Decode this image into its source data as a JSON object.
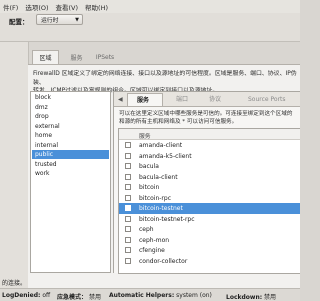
{
  "menubar": {
    "items": [
      "件(F)",
      "选项(O)",
      "查看(V)",
      "帮助(H)"
    ]
  },
  "config": {
    "label": "配置：",
    "value": "运行时"
  },
  "top_tabs": [
    "区域",
    "服务",
    "IPSets"
  ],
  "description": [
    "FirewallD 区域定义了绑定的网络连接、接口以及源地址的可信程度。区域是服务、端口、协议、IP伪装、",
    "转发、ICMP过滤以及富规则的组合。区域可以绑定到接口以及源地址。"
  ],
  "zones": [
    "block",
    "dmz",
    "drop",
    "external",
    "home",
    "internal",
    "public",
    "trusted",
    "work"
  ],
  "selected_zone": "public",
  "sub_tabs": [
    "服务",
    "端口",
    "协议",
    "Source Ports"
  ],
  "service_desc": [
    "可以在这里定义区域中哪些服务是可信的。可连接至绑定到这个区域的",
    "和源的所有主机和网络及 * 可以访问可信服务。"
  ],
  "service_column": "服务",
  "services": [
    {
      "name": "amanda-client",
      "checked": false
    },
    {
      "name": "amanda-k5-client",
      "checked": false
    },
    {
      "name": "bacula",
      "checked": false
    },
    {
      "name": "bacula-client",
      "checked": false
    },
    {
      "name": "bitcoin",
      "checked": false
    },
    {
      "name": "bitcoin-rpc",
      "checked": false
    },
    {
      "name": "bitcoin-testnet",
      "checked": false,
      "selected": true
    },
    {
      "name": "bitcoin-testnet-rpc",
      "checked": false
    },
    {
      "name": "ceph",
      "checked": false
    },
    {
      "name": "ceph-mon",
      "checked": false
    },
    {
      "name": "cfengine",
      "checked": false
    },
    {
      "name": "condor-collector",
      "checked": false
    }
  ],
  "status_message": "的连接。",
  "statusbar": {
    "log_denied_label": "LogDenied:",
    "log_denied_value": "off",
    "panic_label": "应急模式：",
    "panic_value": "禁用",
    "helpers_label": "Automatic Helpers:",
    "helpers_value": "system (on)",
    "lockdown_label": "Lockdown:",
    "lockdown_value": "禁用"
  },
  "colors": {
    "selection": "#4a90d9"
  }
}
